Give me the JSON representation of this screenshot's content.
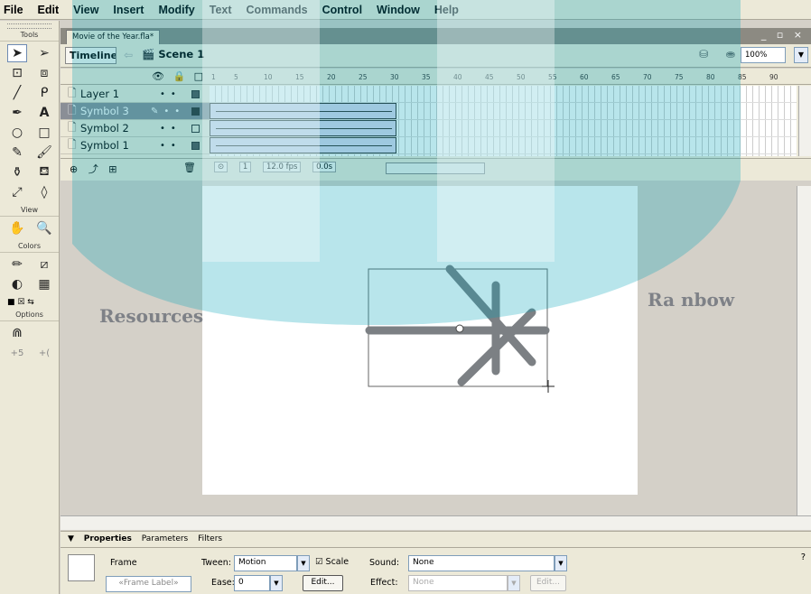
{
  "menu": [
    "File",
    "Edit",
    "View",
    "Insert",
    "Modify",
    "Text",
    "Commands",
    "Control",
    "Window",
    "Help"
  ],
  "tools": {
    "title": "Tools",
    "view_label": "View",
    "colors_label": "Colors",
    "options_label": "Options",
    "items": [
      "selection-arrow-icon",
      "subselection-icon",
      "free-transform-icon",
      "gradient-transform-icon",
      "line-icon",
      "lasso-icon",
      "pen-icon",
      "text-icon",
      "oval-icon",
      "rectangle-icon",
      "pencil-icon",
      "brush-icon",
      "ink-bottle-icon",
      "paint-bucket-icon",
      "eyedropper-icon",
      "eraser-icon"
    ]
  },
  "document": {
    "tab_title": "Movie of the Year.fla*",
    "timeline_button": "Timeline",
    "scene_label": "Scene 1",
    "zoom": "100%",
    "window_controls": "_ ▫ ×"
  },
  "timeline": {
    "ruler_ticks": [
      "1",
      "5",
      "10",
      "15",
      "20",
      "25",
      "30",
      "35",
      "40",
      "45",
      "50",
      "55",
      "60",
      "65",
      "70",
      "75",
      "80",
      "85",
      "90"
    ],
    "layers": [
      {
        "name": "Layer 1",
        "selected": false
      },
      {
        "name": "Symbol 3",
        "selected": true
      },
      {
        "name": "Symbol 2",
        "selected": false
      },
      {
        "name": "Symbol 1",
        "selected": false
      }
    ],
    "current_frame": "1",
    "fps": "12.0 fps",
    "elapsed": "0.0s"
  },
  "stage": {
    "left_text": "Resources",
    "right_text": "Ra nbow"
  },
  "properties": {
    "tabs": [
      "Properties",
      "Parameters",
      "Filters"
    ],
    "frame_label": "Frame",
    "frame_placeholder": "«Frame Label»",
    "tween_label": "Tween:",
    "tween_value": "Motion",
    "scale_label": "Scale",
    "sound_label": "Sound:",
    "sound_value": "None",
    "ease_label": "Ease:",
    "ease_value": "0",
    "edit_button": "Edit...",
    "effect_label": "Effect:",
    "effect_value": "None",
    "effect_edit": "Edit..."
  },
  "colors": {
    "overlay_teal": "#00a2b8",
    "stage": "#ffffff",
    "chrome": "#ece9d8"
  }
}
